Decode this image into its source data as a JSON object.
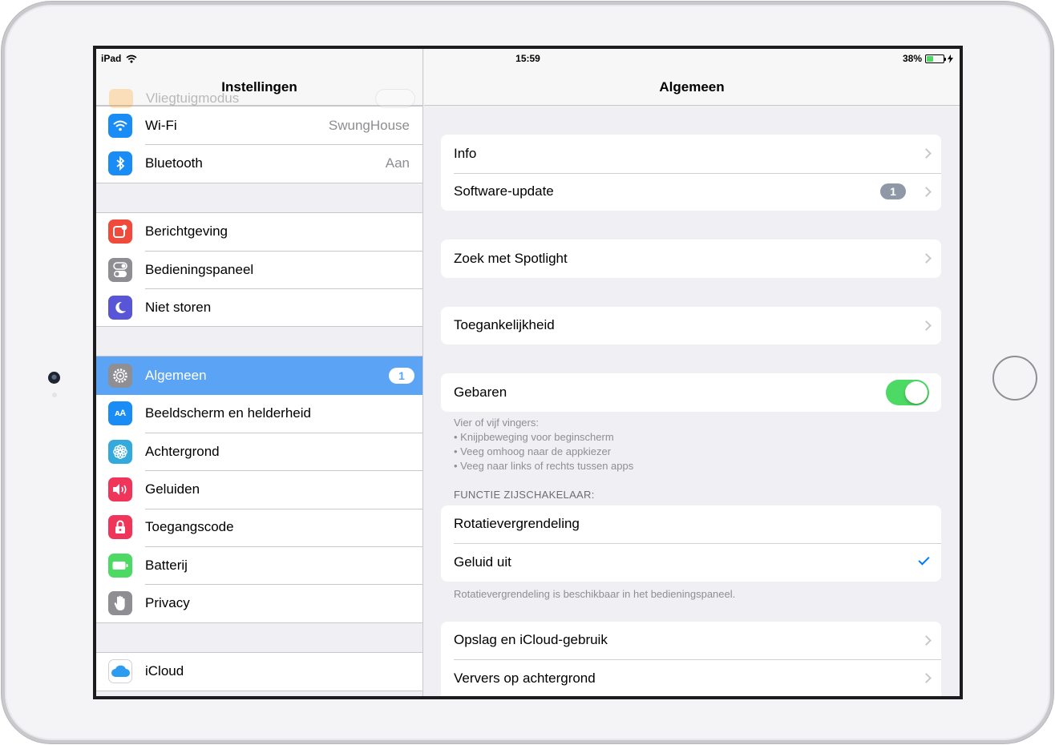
{
  "statusbar": {
    "device": "iPad",
    "time": "15:59",
    "battery_percent": "38%",
    "battery_level": 0.38
  },
  "master": {
    "title": "Instellingen",
    "hidden_row": {
      "label": "Vliegtuigmodus",
      "icon": "airplane-icon",
      "color": "#ff9500"
    },
    "groups": [
      [
        {
          "label": "Wi-Fi",
          "value": "SwungHouse",
          "icon": "wifi-icon",
          "color": "#1a8cf5"
        },
        {
          "label": "Bluetooth",
          "value": "Aan",
          "icon": "bluetooth-icon",
          "color": "#1a8cf5"
        }
      ],
      [
        {
          "label": "Berichtgeving",
          "icon": "notifications-icon",
          "color": "#f04a3a"
        },
        {
          "label": "Bedieningspaneel",
          "icon": "control-center-icon",
          "color": "#8e8e93"
        },
        {
          "label": "Niet storen",
          "icon": "moon-icon",
          "color": "#5856d6"
        }
      ],
      [
        {
          "label": "Algemeen",
          "badge": "1",
          "icon": "gear-icon",
          "color": "#8e8e93",
          "selected": true
        },
        {
          "label": "Beeldscherm en helderheid",
          "icon": "display-icon",
          "color": "#1a8cf5"
        },
        {
          "label": "Achtergrond",
          "icon": "wallpaper-icon",
          "color": "#34aadc"
        },
        {
          "label": "Geluiden",
          "icon": "speaker-icon",
          "color": "#f0355b"
        },
        {
          "label": "Toegangscode",
          "icon": "lock-icon",
          "color": "#f0355b"
        },
        {
          "label": "Batterij",
          "icon": "battery-icon",
          "color": "#4cd964"
        },
        {
          "label": "Privacy",
          "icon": "hand-icon",
          "color": "#8e8e93"
        }
      ],
      [
        {
          "label": "iCloud",
          "icon": "cloud-icon",
          "color": "#ffffff"
        }
      ]
    ]
  },
  "detail": {
    "title": "Algemeen",
    "info": "Info",
    "software_update": "Software-update",
    "software_update_badge": "1",
    "spotlight": "Zoek met Spotlight",
    "accessibility": "Toegankelijkheid",
    "gestures": "Gebaren",
    "gestures_on": true,
    "gestures_note": [
      "Vier of vijf vingers:",
      "• Knijpbeweging voor beginscherm",
      "• Veeg omhoog naar de appkiezer",
      "• Veeg naar links of rechts tussen apps"
    ],
    "side_switch_header": "FUNCTIE ZIJSCHAKELAAR:",
    "rotation_lock": "Rotatievergrendeling",
    "mute": "Geluid uit",
    "side_switch_note": "Rotatievergrendeling is beschikbaar in het bedieningspaneel.",
    "storage": "Opslag en iCloud-gebruik",
    "background_refresh": "Ververs op achtergrond"
  }
}
